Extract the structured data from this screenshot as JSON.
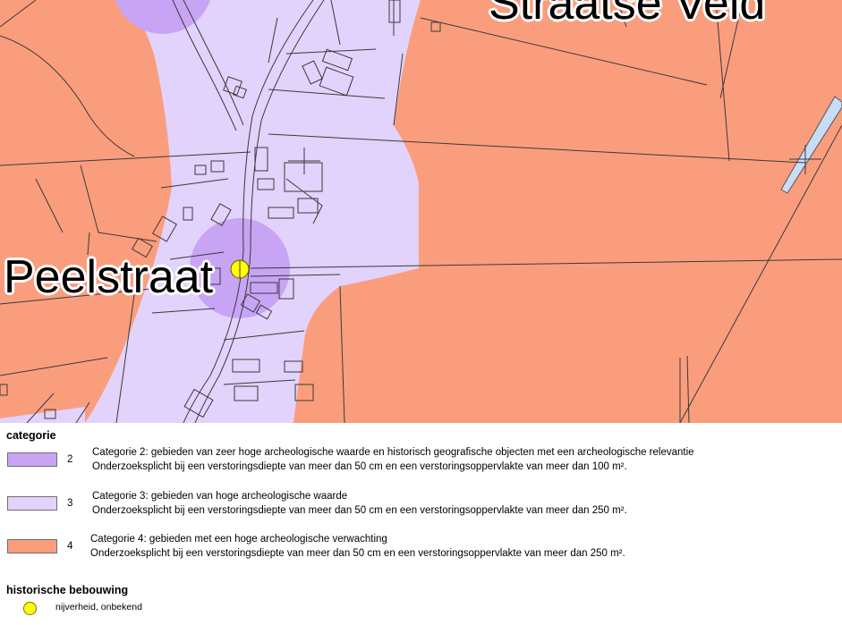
{
  "map": {
    "place_label_main": "Peelstraat",
    "place_label_top": "Straatse Veld",
    "colors": {
      "categorie_2": "#c8a4f4",
      "categorie_3": "#e1d3fb",
      "categorie_4": "#fa9d7d",
      "nijverheid": "#ffff00",
      "water": "#c9dcf5"
    }
  },
  "legend": {
    "categorie_heading": "categorie",
    "items": [
      {
        "number": "2",
        "color": "#c8a4f4",
        "line1": "Categorie 2: gebieden van zeer hoge archeologische waarde en historisch geografische objecten met een archeologische relevantie",
        "line2": "Onderzoeksplicht bij een verstoringsdiepte van meer dan 50 cm en een verstoringsoppervlakte van meer dan 100 m²."
      },
      {
        "number": "3",
        "color": "#e1d3fb",
        "line1": "Categorie 3: gebieden van hoge archeologische waarde",
        "line2": "Onderzoeksplicht bij een verstoringsdiepte van meer dan 50 cm en een verstoringsoppervlakte van meer dan 250 m²."
      },
      {
        "number": "4",
        "color": "#fa9d7d",
        "line1": "Categorie 4: gebieden met een hoge archeologische verwachting",
        "line2": "Onderzoeksplicht bij een verstoringsdiepte van meer dan 50 cm en een verstoringsoppervlakte van meer dan 250 m²."
      }
    ],
    "historische_heading": "historische bebouwing",
    "historische_items": [
      {
        "label": "nijverheid, onbekend",
        "color": "#ffff00"
      }
    ]
  }
}
